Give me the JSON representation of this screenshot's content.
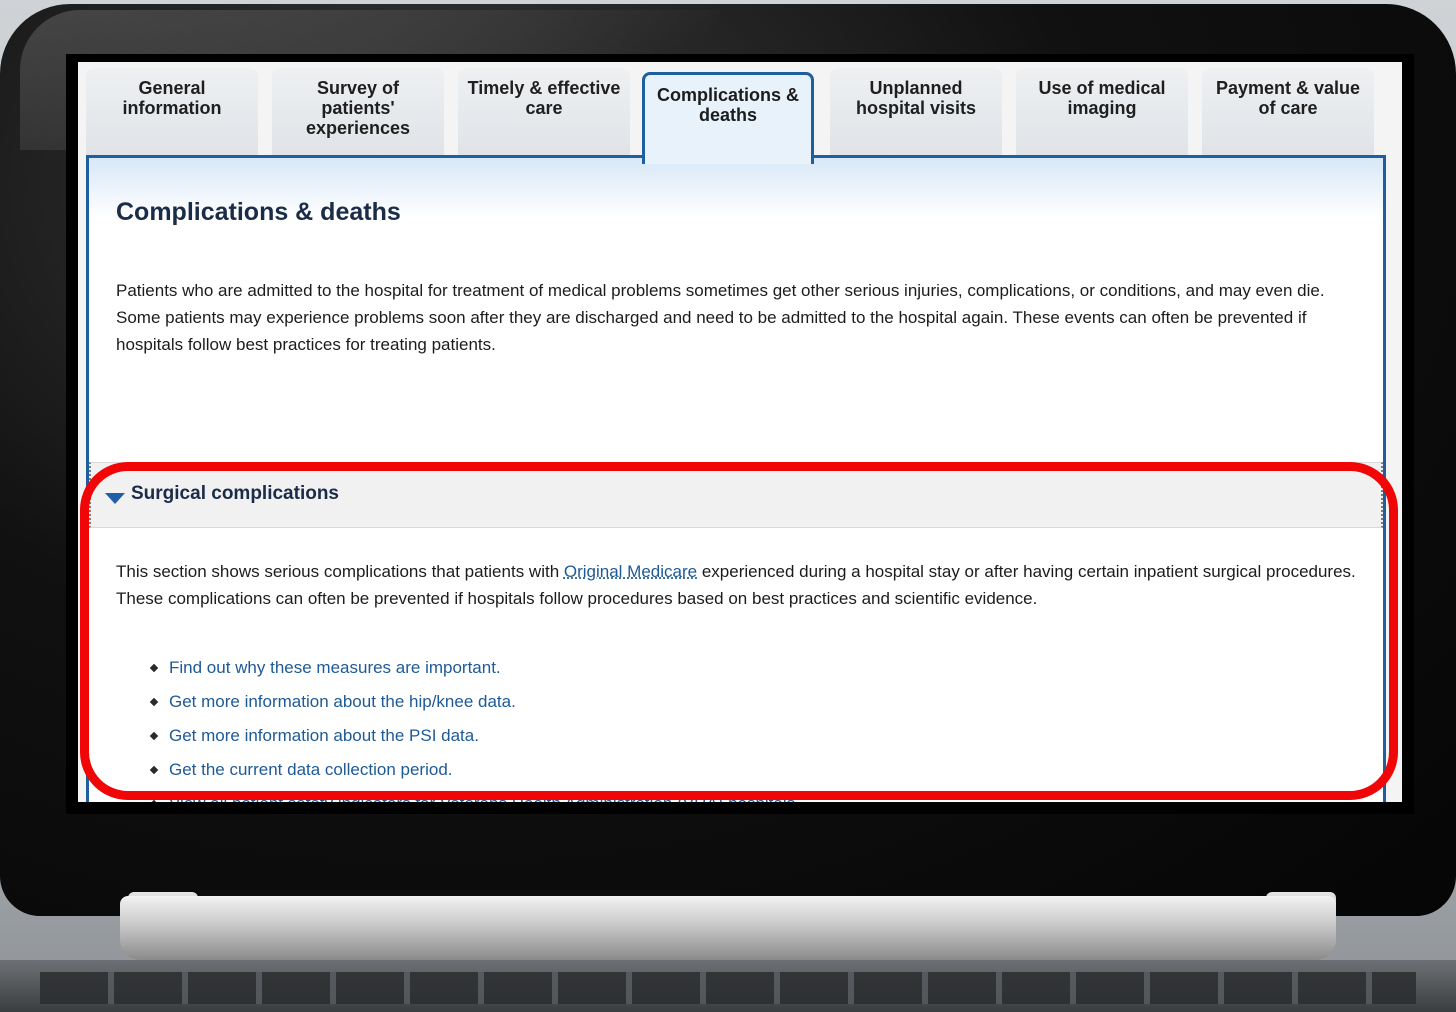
{
  "tabs": [
    {
      "label": "General information",
      "active": false
    },
    {
      "label": "Survey of patients' experiences",
      "active": false
    },
    {
      "label": "Timely & effective care",
      "active": false
    },
    {
      "label": "Complications & deaths",
      "active": true
    },
    {
      "label": "Unplanned hospital visits",
      "active": false
    },
    {
      "label": "Use of medical imaging",
      "active": false
    },
    {
      "label": "Payment & value of care",
      "active": false
    }
  ],
  "main": {
    "title": "Complications & deaths",
    "intro": "Patients who are admitted to the hospital for treatment of medical problems sometimes get other serious injuries, complications, or conditions, and may even die. Some patients may experience problems soon after they are discharged and need to be admitted to the hospital again. These events can often be prevented if hospitals follow best practices for treating patients."
  },
  "section": {
    "title": "Surgical complications",
    "body_before": "This section shows serious complications that patients with ",
    "body_link": "Original Medicare",
    "body_after": " experienced during a hospital stay or after having certain inpatient surgical procedures. These complications can often be prevented if hospitals follow procedures based on best practices and scientific evidence.",
    "links": [
      "Find out why these measures are important.",
      "Get more information about the hip/knee data.",
      "Get more information about the PSI data.",
      "Get the current data collection period.",
      "View all patient safety indicators for Veterans Health Administration (VHA) hospitals."
    ]
  },
  "colors": {
    "accent": "#1e5fa0",
    "link": "#1e5a96",
    "highlight": "#f00606"
  }
}
